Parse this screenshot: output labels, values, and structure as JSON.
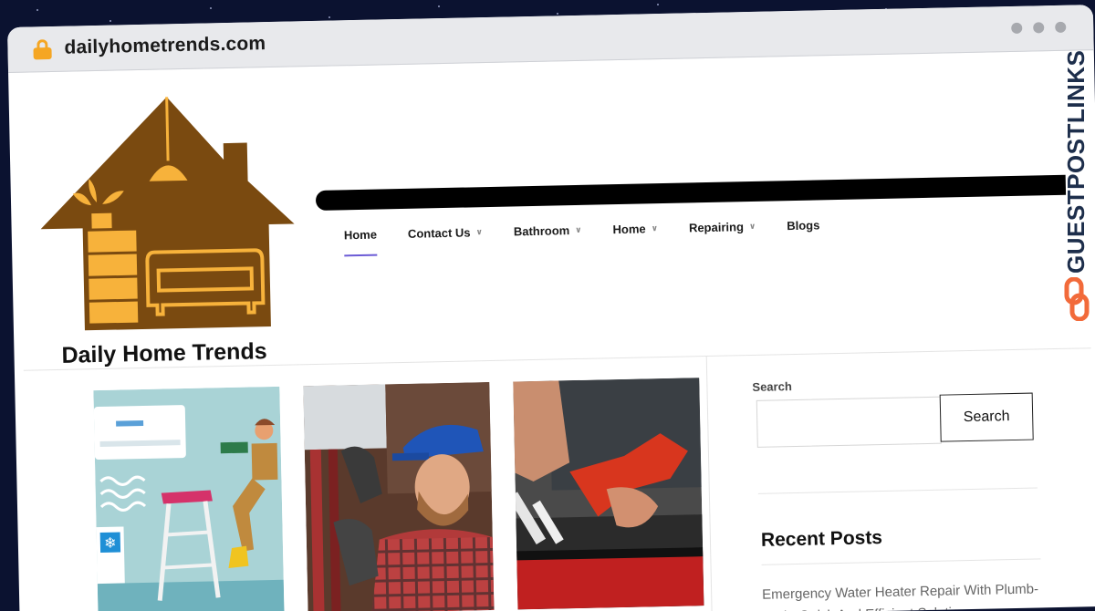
{
  "browser": {
    "url": "dailyhometrends.com"
  },
  "site": {
    "title": "Daily Home Trends"
  },
  "nav": {
    "items": [
      {
        "label": "Home",
        "active": true,
        "dropdown": false
      },
      {
        "label": "Contact Us",
        "active": false,
        "dropdown": true
      },
      {
        "label": "Bathroom",
        "active": false,
        "dropdown": true
      },
      {
        "label": "Home",
        "active": false,
        "dropdown": true
      },
      {
        "label": "Repairing",
        "active": false,
        "dropdown": true
      },
      {
        "label": "Blogs",
        "active": false,
        "dropdown": false
      }
    ]
  },
  "sidebar": {
    "search_label": "Search",
    "search_placeholder": "",
    "search_button": "Search",
    "recent_posts_title": "Recent Posts",
    "recent_posts": [
      "Emergency Water Heater Repair With Plumb-Tech: Quick And Efficient Solutions"
    ]
  },
  "brand": {
    "watermark": "GUESTPOSTLINKS"
  },
  "colors": {
    "logo_brown": "#7a4a10",
    "logo_yellow": "#f7b23b",
    "nav_active_underline": "#6b5bd6",
    "brand_orange": "#f26a3a",
    "brand_navy": "#1d2e4b"
  },
  "icons": {
    "lock": "lock-icon",
    "chevron": "chevron-down-icon",
    "brand_link": "chain-link-icon"
  }
}
